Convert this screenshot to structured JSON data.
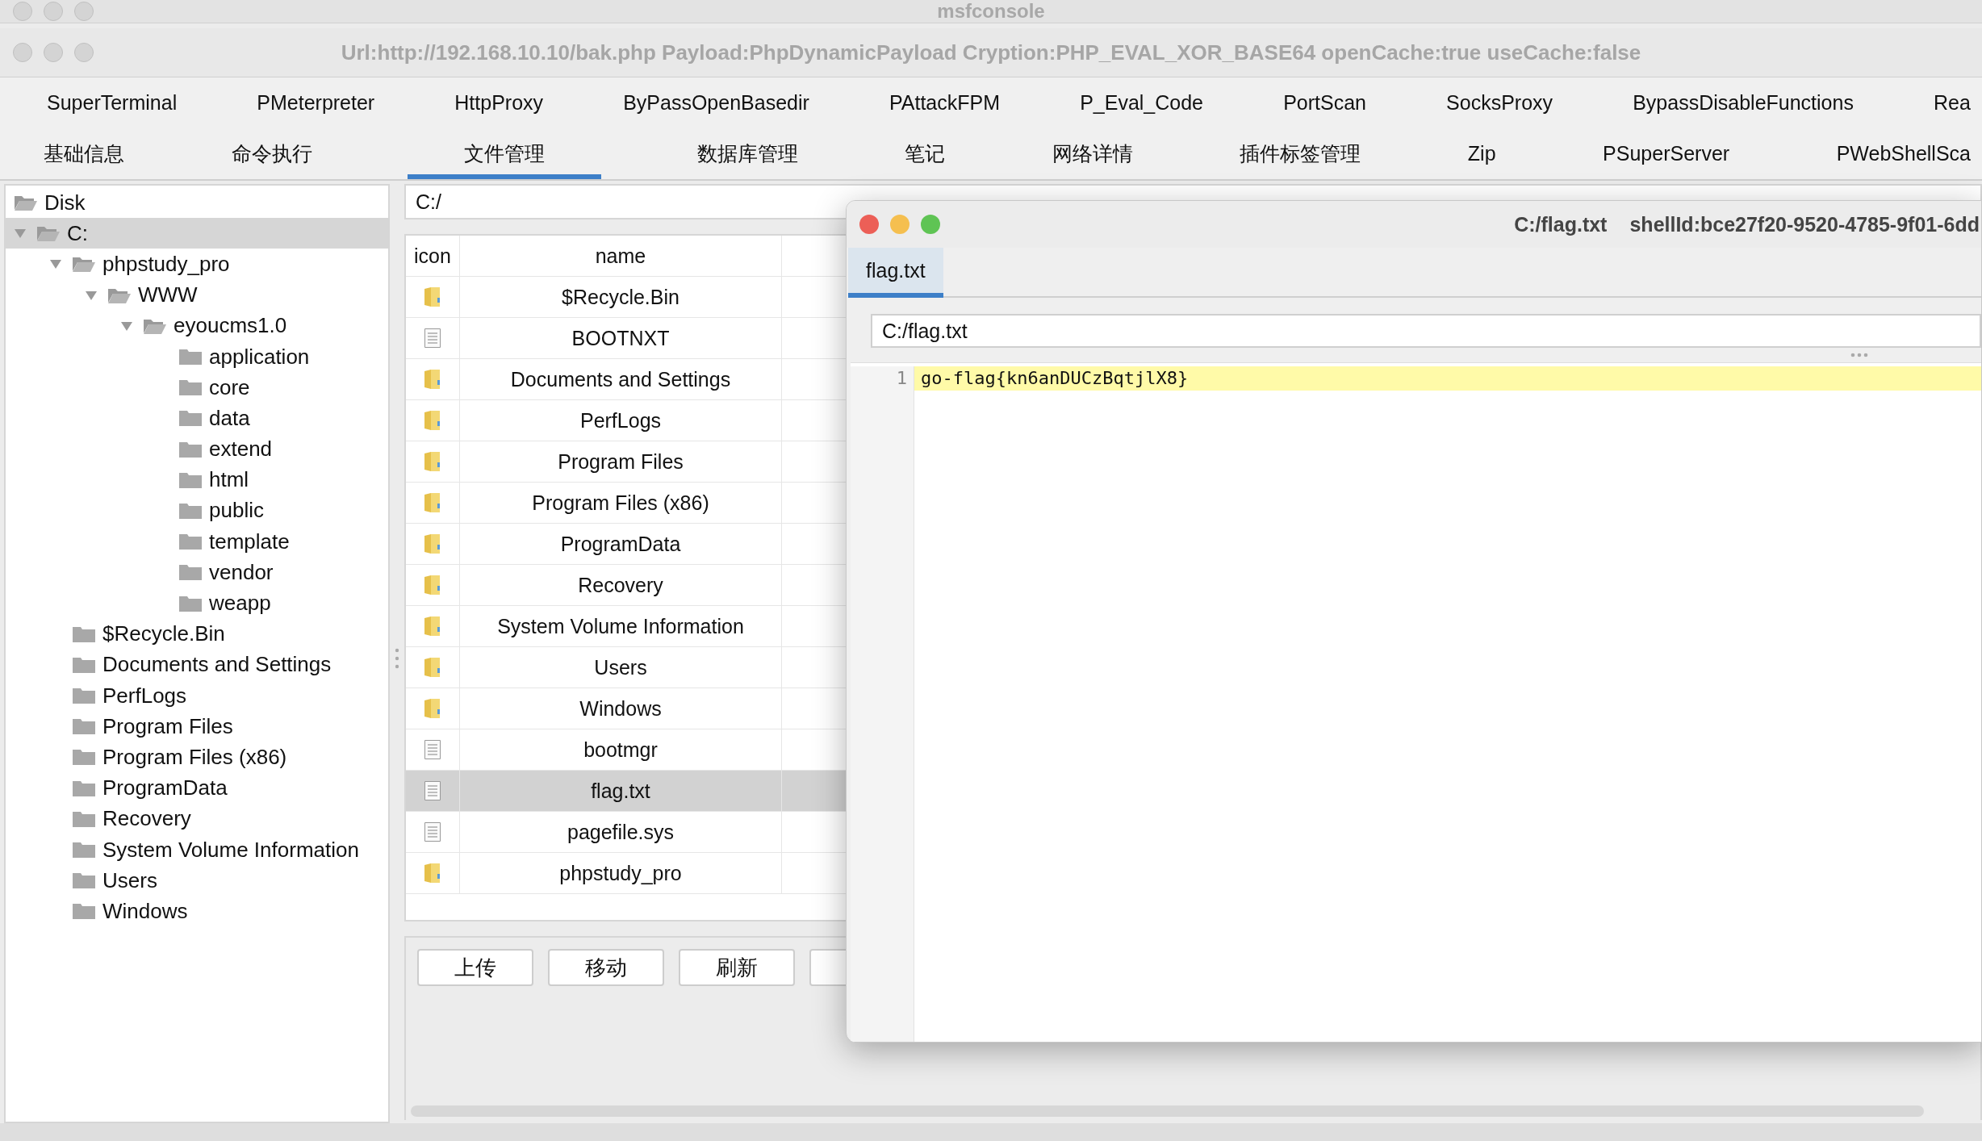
{
  "window": {
    "title": "msfconsole"
  },
  "shell_window": {
    "title": "Url:http://192.168.10.10/bak.php Payload:PhpDynamicPayload Cryption:PHP_EVAL_XOR_BASE64 openCache:true useCache:false"
  },
  "plugin_tabs": [
    {
      "label": "SuperTerminal",
      "selected": false
    },
    {
      "label": "PMeterpreter",
      "selected": false
    },
    {
      "label": "HttpProxy",
      "selected": false
    },
    {
      "label": "ByPassOpenBasedir",
      "selected": false
    },
    {
      "label": "PAttackFPM",
      "selected": false
    },
    {
      "label": "P_Eval_Code",
      "selected": false
    },
    {
      "label": "PortScan",
      "selected": false
    },
    {
      "label": "SocksProxy",
      "selected": false
    },
    {
      "label": "BypassDisableFunctions",
      "selected": false
    },
    {
      "label": "Rea",
      "selected": false
    }
  ],
  "module_tabs": [
    {
      "label": "基础信息",
      "selected": false
    },
    {
      "label": "命令执行",
      "selected": false
    },
    {
      "label": "文件管理",
      "selected": true
    },
    {
      "label": "数据库管理",
      "selected": false
    },
    {
      "label": "笔记",
      "selected": false
    },
    {
      "label": "网络详情",
      "selected": false
    },
    {
      "label": "插件标签管理",
      "selected": false
    },
    {
      "label": "Zip",
      "selected": false
    },
    {
      "label": "PSuperServer",
      "selected": false
    },
    {
      "label": "PWebShellSca",
      "selected": false
    }
  ],
  "tree": {
    "root": "Disk",
    "items": [
      {
        "label": "C:",
        "selected": true,
        "expanded": true,
        "children": [
          {
            "label": "phpstudy_pro",
            "selected": false,
            "expanded": true,
            "children": [
              {
                "label": "WWW",
                "selected": false,
                "expanded": true,
                "children": [
                  {
                    "label": "eyoucms1.0",
                    "selected": false,
                    "expanded": true,
                    "children": [
                      {
                        "label": "application",
                        "selected": false
                      },
                      {
                        "label": "core",
                        "selected": false
                      },
                      {
                        "label": "data",
                        "selected": false
                      },
                      {
                        "label": "extend",
                        "selected": false
                      },
                      {
                        "label": "html",
                        "selected": false
                      },
                      {
                        "label": "public",
                        "selected": false
                      },
                      {
                        "label": "template",
                        "selected": false
                      },
                      {
                        "label": "vendor",
                        "selected": false
                      },
                      {
                        "label": "weapp",
                        "selected": false
                      }
                    ]
                  }
                ]
              }
            ]
          },
          {
            "label": "$Recycle.Bin",
            "selected": false
          },
          {
            "label": "Documents and Settings",
            "selected": false
          },
          {
            "label": "PerfLogs",
            "selected": false
          },
          {
            "label": "Program Files",
            "selected": false
          },
          {
            "label": "Program Files (x86)",
            "selected": false
          },
          {
            "label": "ProgramData",
            "selected": false
          },
          {
            "label": "Recovery",
            "selected": false
          },
          {
            "label": "System Volume Information",
            "selected": false
          },
          {
            "label": "Users",
            "selected": false
          },
          {
            "label": "Windows",
            "selected": false
          }
        ]
      }
    ]
  },
  "path": "C:/",
  "file_table": {
    "columns": [
      "icon",
      "name"
    ],
    "rows": [
      {
        "kind": "folder",
        "name": "$Recycle.Bin",
        "selected": false
      },
      {
        "kind": "file",
        "name": "BOOTNXT",
        "selected": false
      },
      {
        "kind": "folder",
        "name": "Documents and Settings",
        "selected": false
      },
      {
        "kind": "folder",
        "name": "PerfLogs",
        "selected": false
      },
      {
        "kind": "folder",
        "name": "Program Files",
        "selected": false
      },
      {
        "kind": "folder",
        "name": "Program Files (x86)",
        "selected": false
      },
      {
        "kind": "folder",
        "name": "ProgramData",
        "selected": false
      },
      {
        "kind": "folder",
        "name": "Recovery",
        "selected": false
      },
      {
        "kind": "folder",
        "name": "System Volume Information",
        "selected": false
      },
      {
        "kind": "folder",
        "name": "Users",
        "selected": false
      },
      {
        "kind": "folder",
        "name": "Windows",
        "selected": false
      },
      {
        "kind": "file",
        "name": "bootmgr",
        "selected": false
      },
      {
        "kind": "file",
        "name": "flag.txt",
        "selected": true
      },
      {
        "kind": "file",
        "name": "pagefile.sys",
        "selected": false
      },
      {
        "kind": "folder",
        "name": "phpstudy_pro",
        "selected": false
      }
    ]
  },
  "buttons": [
    "上传",
    "移动",
    "刷新"
  ],
  "editor_window": {
    "title": "C:/flag.txt",
    "shell_id": "shellId:bce27f20-9520-4785-9f01-6dd",
    "tabs": [
      {
        "label": "flag.txt",
        "selected": true
      }
    ],
    "path": "C:/flag.txt",
    "lines": [
      {
        "number": "1",
        "text": "go-flag{kn6anDUCzBqtjlX8}",
        "highlighted": true
      }
    ]
  }
}
